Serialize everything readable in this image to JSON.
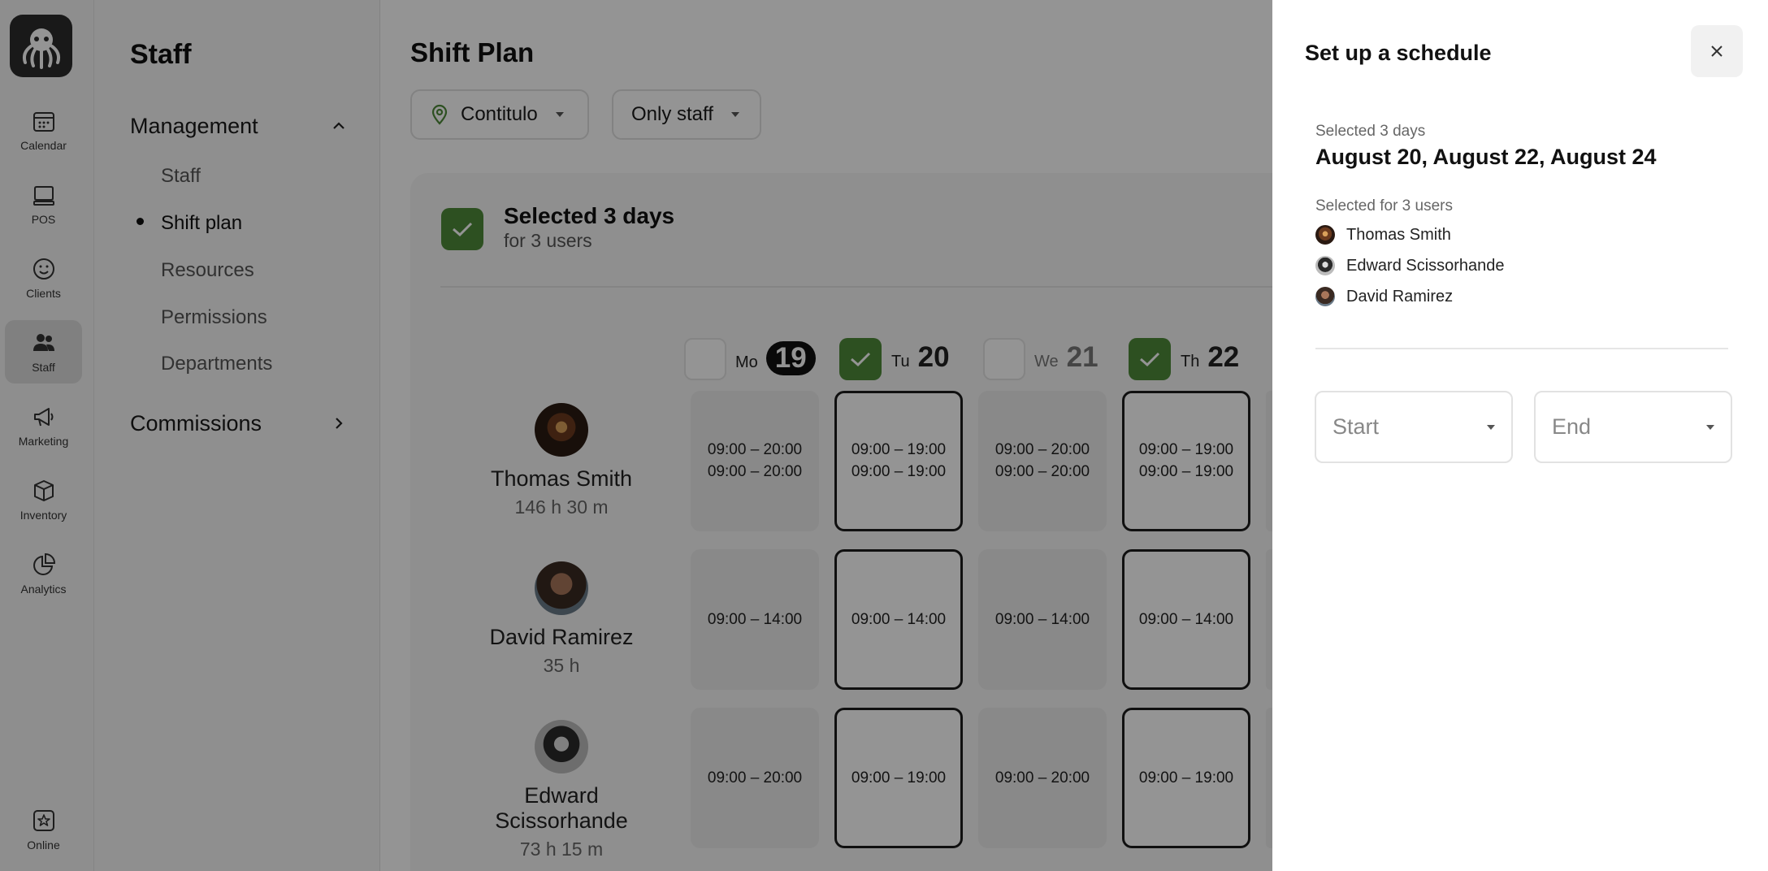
{
  "rail": {
    "items": [
      {
        "label": "Calendar",
        "icon": "calendar-icon"
      },
      {
        "label": "POS",
        "icon": "pos-icon"
      },
      {
        "label": "Clients",
        "icon": "smile-icon"
      },
      {
        "label": "Staff",
        "icon": "users-icon"
      },
      {
        "label": "Marketing",
        "icon": "megaphone-icon"
      },
      {
        "label": "Inventory",
        "icon": "box-icon"
      },
      {
        "label": "Analytics",
        "icon": "pie-chart-icon"
      }
    ],
    "online_label": "Online"
  },
  "sidebar": {
    "title": "Staff",
    "management": "Management",
    "items": [
      {
        "label": "Staff"
      },
      {
        "label": "Shift plan"
      },
      {
        "label": "Resources"
      },
      {
        "label": "Permissions"
      },
      {
        "label": "Departments"
      }
    ],
    "commissions": "Commissions"
  },
  "main": {
    "title": "Shift Plan",
    "location_filter": "Contitulo",
    "staff_filter": "Only staff",
    "selection_title": "Selected 3 days",
    "selection_sub": "for 3 users",
    "days": [
      {
        "name": "Mo",
        "date": "19",
        "selected": false
      },
      {
        "name": "Tu",
        "date": "20",
        "selected": true
      },
      {
        "name": "We",
        "date": "21",
        "selected": false
      },
      {
        "name": "Th",
        "date": "22",
        "selected": true
      }
    ],
    "staff": [
      {
        "name": "Thomas Smith",
        "hours": "146 h 30 m",
        "shifts": [
          [
            "09:00 – 20:00",
            "09:00 – 20:00"
          ],
          [
            "09:00 – 19:00",
            "09:00 – 19:00"
          ],
          [
            "09:00 – 20:00",
            "09:00 – 20:00"
          ],
          [
            "09:00 – 19:00",
            "09:00 – 19:00"
          ]
        ]
      },
      {
        "name": "David Ramirez",
        "hours": "35 h",
        "shifts": [
          [
            "09:00 – 14:00"
          ],
          [
            "09:00 – 14:00"
          ],
          [
            "09:00 – 14:00"
          ],
          [
            "09:00 – 14:00"
          ]
        ]
      },
      {
        "name": "Edward Scissorhande",
        "hours": "73 h 15 m",
        "shifts": [
          [
            "09:00 – 20:00"
          ],
          [
            "09:00 – 19:00"
          ],
          [
            "09:00 – 20:00"
          ],
          [
            "09:00 – 19:00"
          ]
        ]
      }
    ]
  },
  "drawer": {
    "title": "Set up a schedule",
    "selected_days_label": "Selected 3 days",
    "selected_dates": "August 20, August 22, August 24",
    "selected_users_label": "Selected for 3 users",
    "users": [
      "Thomas Smith",
      "Edward Scissorhande",
      "David Ramirez"
    ],
    "start_placeholder": "Start",
    "end_placeholder": "End"
  },
  "colors": {
    "accent_green": "#4f8b3a",
    "overlay": "rgba(0,0,0,0.42)"
  }
}
